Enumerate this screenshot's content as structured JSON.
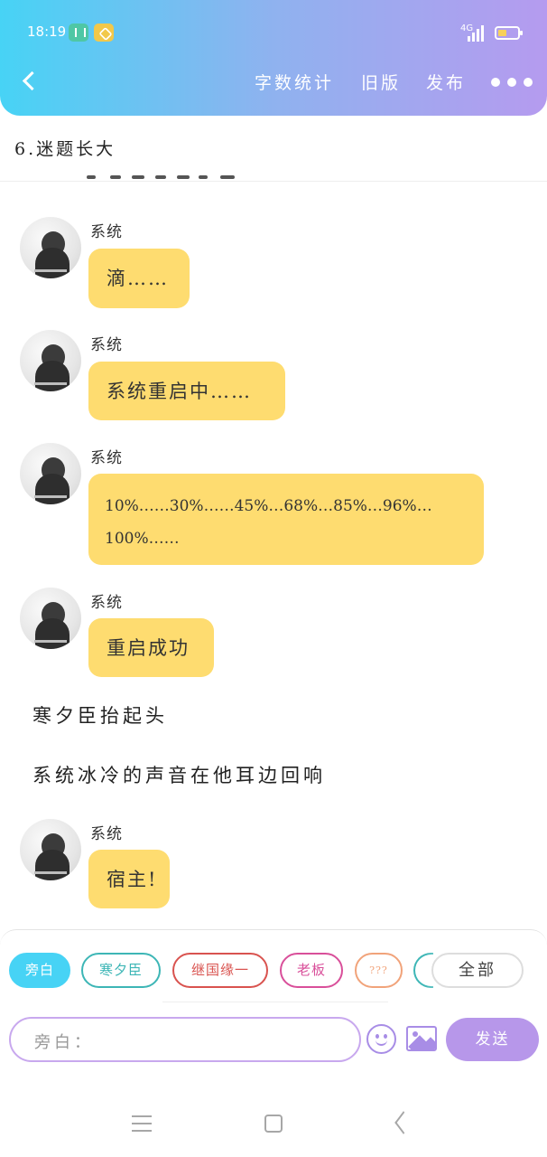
{
  "status_bar": {
    "time": "18:19",
    "network": "4G"
  },
  "header": {
    "word_count": "字数统计",
    "old_version": "旧版",
    "publish": "发布"
  },
  "chapter_title": "6.迷题长大",
  "messages": [
    {
      "sender": "系统",
      "lines": [
        "滴……"
      ]
    },
    {
      "sender": "系统",
      "lines": [
        "系统重启中……"
      ]
    },
    {
      "sender": "系统",
      "lines": [
        "10%……30%……45%…68%…85%…96%…",
        "100%……"
      ]
    },
    {
      "sender": "系统",
      "lines": [
        "重启成功"
      ]
    },
    {
      "sender": "系统",
      "lines": [
        "宿主!"
      ]
    }
  ],
  "narrations": [
    "寒夕臣抬起头",
    "系统冰冷的声音在他耳边回响"
  ],
  "characters": [
    {
      "name": "旁白",
      "color": "#47d3f5",
      "active": true
    },
    {
      "name": "寒夕臣",
      "color": "#3db6b6",
      "active": false
    },
    {
      "name": "继国缘一",
      "color": "#d9534f",
      "active": false
    },
    {
      "name": "老板",
      "color": "#d94f9a",
      "active": false
    },
    {
      "name": "???",
      "color": "#f1a37a",
      "active": false
    }
  ],
  "all_label": "全部",
  "input": {
    "label": "旁白："
  },
  "send_label": "发送",
  "colors": {
    "bubble": "#fedc70",
    "header_start": "#47d3f5",
    "header_end": "#b59bef",
    "accent": "#b797ea"
  }
}
